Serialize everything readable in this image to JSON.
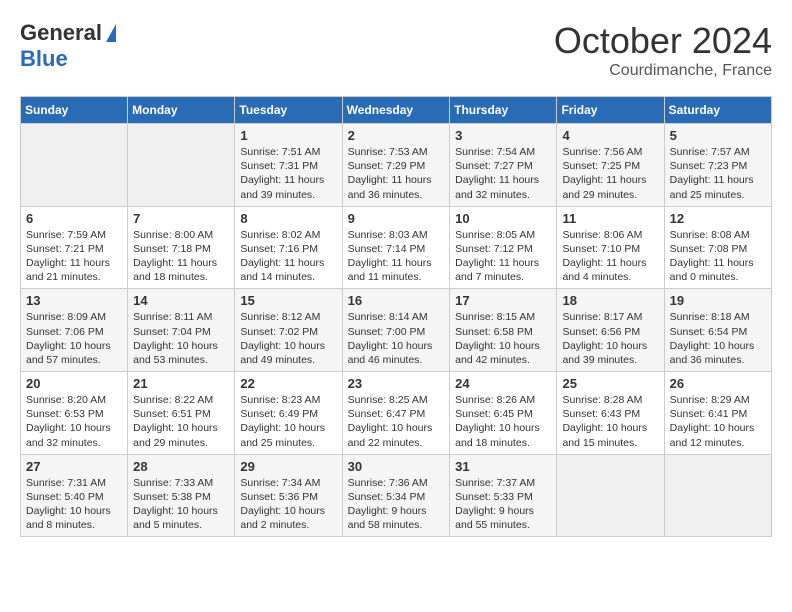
{
  "header": {
    "logo_general": "General",
    "logo_blue": "Blue",
    "month_title": "October 2024",
    "location": "Courdimanche, France"
  },
  "days_of_week": [
    "Sunday",
    "Monday",
    "Tuesday",
    "Wednesday",
    "Thursday",
    "Friday",
    "Saturday"
  ],
  "weeks": [
    [
      {
        "day": "",
        "info": ""
      },
      {
        "day": "",
        "info": ""
      },
      {
        "day": "1",
        "info": "Sunrise: 7:51 AM\nSunset: 7:31 PM\nDaylight: 11 hours and 39 minutes."
      },
      {
        "day": "2",
        "info": "Sunrise: 7:53 AM\nSunset: 7:29 PM\nDaylight: 11 hours and 36 minutes."
      },
      {
        "day": "3",
        "info": "Sunrise: 7:54 AM\nSunset: 7:27 PM\nDaylight: 11 hours and 32 minutes."
      },
      {
        "day": "4",
        "info": "Sunrise: 7:56 AM\nSunset: 7:25 PM\nDaylight: 11 hours and 29 minutes."
      },
      {
        "day": "5",
        "info": "Sunrise: 7:57 AM\nSunset: 7:23 PM\nDaylight: 11 hours and 25 minutes."
      }
    ],
    [
      {
        "day": "6",
        "info": "Sunrise: 7:59 AM\nSunset: 7:21 PM\nDaylight: 11 hours and 21 minutes."
      },
      {
        "day": "7",
        "info": "Sunrise: 8:00 AM\nSunset: 7:18 PM\nDaylight: 11 hours and 18 minutes."
      },
      {
        "day": "8",
        "info": "Sunrise: 8:02 AM\nSunset: 7:16 PM\nDaylight: 11 hours and 14 minutes."
      },
      {
        "day": "9",
        "info": "Sunrise: 8:03 AM\nSunset: 7:14 PM\nDaylight: 11 hours and 11 minutes."
      },
      {
        "day": "10",
        "info": "Sunrise: 8:05 AM\nSunset: 7:12 PM\nDaylight: 11 hours and 7 minutes."
      },
      {
        "day": "11",
        "info": "Sunrise: 8:06 AM\nSunset: 7:10 PM\nDaylight: 11 hours and 4 minutes."
      },
      {
        "day": "12",
        "info": "Sunrise: 8:08 AM\nSunset: 7:08 PM\nDaylight: 11 hours and 0 minutes."
      }
    ],
    [
      {
        "day": "13",
        "info": "Sunrise: 8:09 AM\nSunset: 7:06 PM\nDaylight: 10 hours and 57 minutes."
      },
      {
        "day": "14",
        "info": "Sunrise: 8:11 AM\nSunset: 7:04 PM\nDaylight: 10 hours and 53 minutes."
      },
      {
        "day": "15",
        "info": "Sunrise: 8:12 AM\nSunset: 7:02 PM\nDaylight: 10 hours and 49 minutes."
      },
      {
        "day": "16",
        "info": "Sunrise: 8:14 AM\nSunset: 7:00 PM\nDaylight: 10 hours and 46 minutes."
      },
      {
        "day": "17",
        "info": "Sunrise: 8:15 AM\nSunset: 6:58 PM\nDaylight: 10 hours and 42 minutes."
      },
      {
        "day": "18",
        "info": "Sunrise: 8:17 AM\nSunset: 6:56 PM\nDaylight: 10 hours and 39 minutes."
      },
      {
        "day": "19",
        "info": "Sunrise: 8:18 AM\nSunset: 6:54 PM\nDaylight: 10 hours and 36 minutes."
      }
    ],
    [
      {
        "day": "20",
        "info": "Sunrise: 8:20 AM\nSunset: 6:53 PM\nDaylight: 10 hours and 32 minutes."
      },
      {
        "day": "21",
        "info": "Sunrise: 8:22 AM\nSunset: 6:51 PM\nDaylight: 10 hours and 29 minutes."
      },
      {
        "day": "22",
        "info": "Sunrise: 8:23 AM\nSunset: 6:49 PM\nDaylight: 10 hours and 25 minutes."
      },
      {
        "day": "23",
        "info": "Sunrise: 8:25 AM\nSunset: 6:47 PM\nDaylight: 10 hours and 22 minutes."
      },
      {
        "day": "24",
        "info": "Sunrise: 8:26 AM\nSunset: 6:45 PM\nDaylight: 10 hours and 18 minutes."
      },
      {
        "day": "25",
        "info": "Sunrise: 8:28 AM\nSunset: 6:43 PM\nDaylight: 10 hours and 15 minutes."
      },
      {
        "day": "26",
        "info": "Sunrise: 8:29 AM\nSunset: 6:41 PM\nDaylight: 10 hours and 12 minutes."
      }
    ],
    [
      {
        "day": "27",
        "info": "Sunrise: 7:31 AM\nSunset: 5:40 PM\nDaylight: 10 hours and 8 minutes."
      },
      {
        "day": "28",
        "info": "Sunrise: 7:33 AM\nSunset: 5:38 PM\nDaylight: 10 hours and 5 minutes."
      },
      {
        "day": "29",
        "info": "Sunrise: 7:34 AM\nSunset: 5:36 PM\nDaylight: 10 hours and 2 minutes."
      },
      {
        "day": "30",
        "info": "Sunrise: 7:36 AM\nSunset: 5:34 PM\nDaylight: 9 hours and 58 minutes."
      },
      {
        "day": "31",
        "info": "Sunrise: 7:37 AM\nSunset: 5:33 PM\nDaylight: 9 hours and 55 minutes."
      },
      {
        "day": "",
        "info": ""
      },
      {
        "day": "",
        "info": ""
      }
    ]
  ]
}
